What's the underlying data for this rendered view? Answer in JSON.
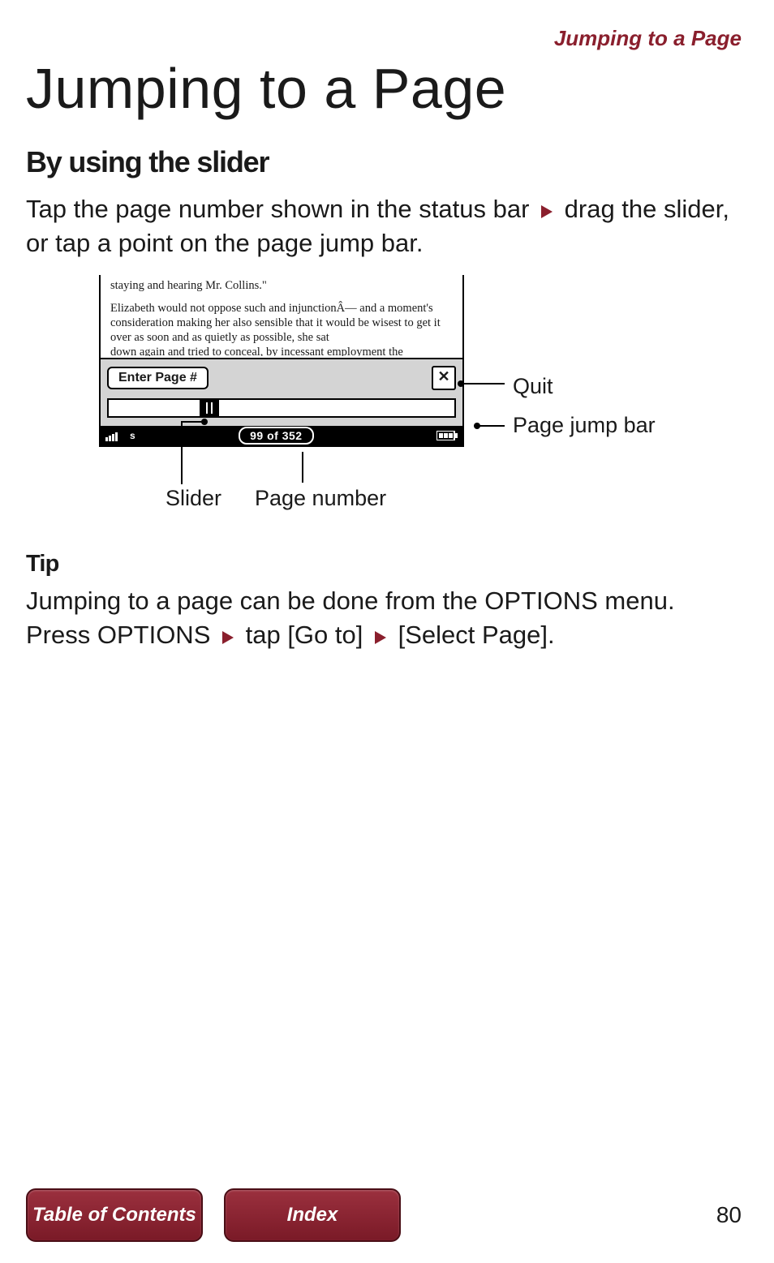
{
  "header": {
    "running_head": "Jumping to a Page"
  },
  "title": "Jumping to a Page",
  "section1": {
    "heading": "By using the slider",
    "para_a": "Tap the page number shown in the status bar ",
    "para_b": " drag the slider, or tap a point on the page jump bar."
  },
  "diagram": {
    "reader_text_line1": "staying and hearing Mr. Collins.\"",
    "reader_text_para": "Elizabeth would not oppose such and injunctionÂ— and a moment's consideration making her also sensible that it would be wisest to get it over as soon and as quietly as possible, she sat",
    "reader_text_cut": "down again and tried to conceal, by incessant employment the",
    "enter_button": "Enter Page #",
    "close_glyph": "✕",
    "page_indicator": "99 of 352",
    "callouts": {
      "quit": "Quit",
      "page_jump_bar": "Page jump bar",
      "slider": "Slider",
      "page_number": "Page number"
    }
  },
  "tip": {
    "heading": "Tip",
    "line1_a": "Jumping to a page can be done from the OPTIONS menu. Press OPTIONS ",
    "line1_b": " tap [Go to] ",
    "line1_c": " [Select Page]."
  },
  "footer": {
    "toc": "Table of Contents",
    "index": "Index",
    "page_no": "80"
  }
}
